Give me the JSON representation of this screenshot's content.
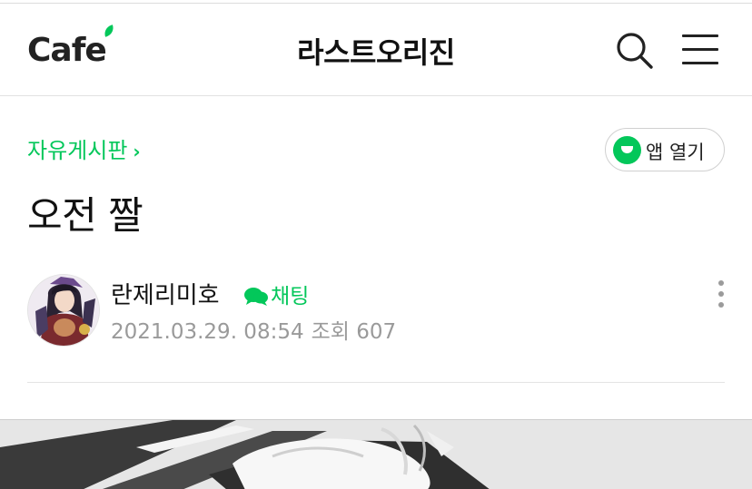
{
  "header": {
    "logo_text": "Cafe",
    "cafe_name": "라스트오리진",
    "search_icon": "search-icon",
    "menu_icon": "hamburger-menu-icon"
  },
  "post": {
    "board_name": "자유게시판",
    "board_chevron": "›",
    "app_open_label": "앱 열기",
    "title": "오전 짤",
    "author": "란제리미호",
    "chat_label": "채팅",
    "date": "2021.03.29. 08:54",
    "views_label": "조회 607"
  },
  "colors": {
    "brand_green": "#03c75a",
    "meta_gray": "#9a9a9a",
    "text": "#111111"
  }
}
